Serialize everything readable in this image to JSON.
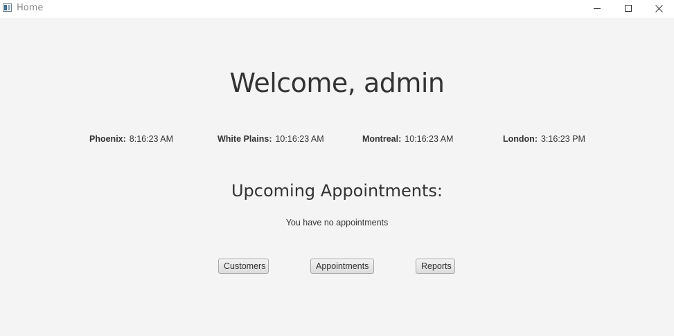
{
  "window": {
    "title": "Home",
    "icon": "java-app-icon",
    "controls": [
      "minimize-icon",
      "maximize-icon",
      "close-icon"
    ]
  },
  "main": {
    "welcome": "Welcome, admin",
    "clocks": [
      {
        "city": "Phoenix:",
        "time": "8:16:23 AM"
      },
      {
        "city": "White Plains:",
        "time": "10:16:23 AM"
      },
      {
        "city": "Montreal:",
        "time": "10:16:23 AM"
      },
      {
        "city": "London:",
        "time": "3:16:23 PM"
      }
    ],
    "upcoming_title": "Upcoming Appointments:",
    "no_appointments": "You have no appointments"
  },
  "buttons": {
    "customers": "Customers",
    "appointments": "Appointments",
    "reports": "Reports"
  },
  "colors": {
    "background": "#f4f4f4",
    "titlebar": "#ffffff",
    "text": "#333333"
  }
}
